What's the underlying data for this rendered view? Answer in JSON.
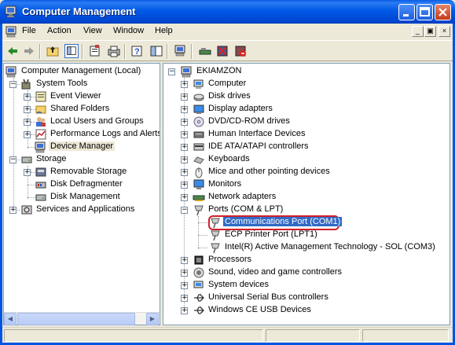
{
  "window": {
    "title": "Computer Management"
  },
  "menubar": {
    "items": [
      "File",
      "Action",
      "View",
      "Window",
      "Help"
    ]
  },
  "toolbar": {
    "icons": [
      "back-icon",
      "forward-icon",
      "up-folder-icon",
      "show-hide-tree-icon",
      "properties-icon",
      "print-icon",
      "help-icon",
      "export-list-icon",
      "scan-hardware-icon",
      "update-driver-icon",
      "uninstall-icon",
      "disable-icon"
    ]
  },
  "left_tree": {
    "root": "Computer Management (Local)",
    "system_tools": "System Tools",
    "event_viewer": "Event Viewer",
    "shared_folders": "Shared Folders",
    "local_users": "Local Users and Groups",
    "perf_logs": "Performance Logs and Alerts",
    "device_manager": "Device Manager",
    "storage": "Storage",
    "removable_storage": "Removable Storage",
    "disk_defrag": "Disk Defragmenter",
    "disk_mgmt": "Disk Management",
    "services_apps": "Services and Applications"
  },
  "right_tree": {
    "root": "EKIAMZON",
    "items": [
      "Computer",
      "Disk drives",
      "Display adapters",
      "DVD/CD-ROM drives",
      "Human Interface Devices",
      "IDE ATA/ATAPI controllers",
      "Keyboards",
      "Mice and other pointing devices",
      "Monitors",
      "Network adapters",
      "Ports (COM & LPT)"
    ],
    "ports": [
      "Communications Port (COM1)",
      "ECP Printer Port (LPT1)",
      "Intel(R) Active Management Technology - SOL (COM3)"
    ],
    "items_after": [
      "Processors",
      "Sound, video and game controllers",
      "System devices",
      "Universal Serial Bus controllers",
      "Windows CE USB Devices"
    ]
  },
  "colors": {
    "title_blue": "#0058e6",
    "selection": "#316ac5",
    "highlight_red": "#d0202a"
  }
}
